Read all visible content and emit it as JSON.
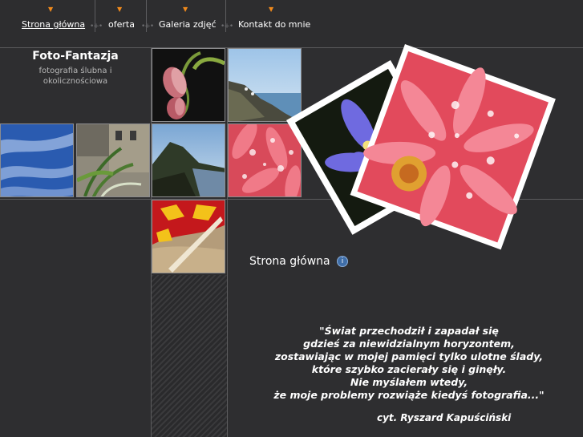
{
  "nav": {
    "items": [
      {
        "label": "Strona główna",
        "active": true
      },
      {
        "label": "oferta"
      },
      {
        "label": "Galeria zdjęć"
      },
      {
        "label": "Kontakt do mnie"
      }
    ]
  },
  "brand": {
    "title": "Foto-Fantazja",
    "subtitle_line1": "fotografia ślubna i",
    "subtitle_line2": "okolicznościowa"
  },
  "photos": [
    {
      "subject": "pink tulip buds"
    },
    {
      "subject": "rocky coastline"
    },
    {
      "subject": "blue sky with clouds"
    },
    {
      "subject": "old town street with plant"
    },
    {
      "subject": "mountain landscape"
    },
    {
      "subject": "pink gerbera with droplets"
    },
    {
      "subject": "beach umbrella and sand"
    }
  ],
  "collage": {
    "photo_a": "blue crocus flower",
    "photo_b": "pink gerbera close-up"
  },
  "main": {
    "title": "Strona główna",
    "icon": "info-icon",
    "quote_lines": [
      "\"Świat przechodził i zapadał się",
      "gdzieś za niewidzialnym horyzontem,",
      "zostawiając w mojej pamięci tylko ulotne ślady,",
      "które szybko zacierały się i ginęły.",
      "Nie myślałem wtedy,",
      "że moje problemy rozwiąże kiedyś fotografia...\""
    ],
    "citation": "cyt. Ryszard Kapuściński"
  },
  "colors": {
    "background": "#2e2e30",
    "accent_arrow": "#f08a1c",
    "text": "#ffffff"
  }
}
